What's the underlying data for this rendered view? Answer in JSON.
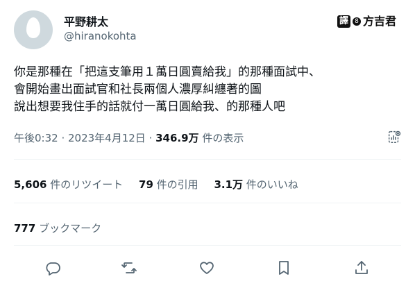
{
  "user": {
    "display_name": "平野耕太",
    "handle": "@hiranokohta"
  },
  "watermark": {
    "box_char": "譯",
    "dot_char": "8",
    "name": "方吉君"
  },
  "tweet": {
    "lines": [
      "你是那種在「把這支筆用１萬日圓賣給我」的那種面試中、",
      "會開始畫出面試官和社長兩個人濃厚糾纏著的圖",
      "說出想要我住手的話就付一萬日圓給我、的那種人吧"
    ]
  },
  "meta": {
    "timestamp": "午後0:32 · 2023年4月12日 · ",
    "views_count": "346.9万",
    "views_label": " 件の表示",
    "analytics_icon": "analytics-icon"
  },
  "stats": {
    "retweets_count": "5,606",
    "retweets_label": " 件のリツイート",
    "quotes_count": "79",
    "quotes_label": " 件の引用",
    "likes_count": "3.1万",
    "likes_label": " 件のいいね"
  },
  "bookmarks": {
    "count": "777",
    "label": " ブックマーク"
  },
  "actions": [
    "reply-icon",
    "retweet-icon",
    "like-icon",
    "bookmark-icon",
    "share-icon"
  ],
  "colors": {
    "text": "#0f1419",
    "secondary": "#536471",
    "divider": "#eff3f4",
    "avatar_bg": "#cfd9de"
  }
}
